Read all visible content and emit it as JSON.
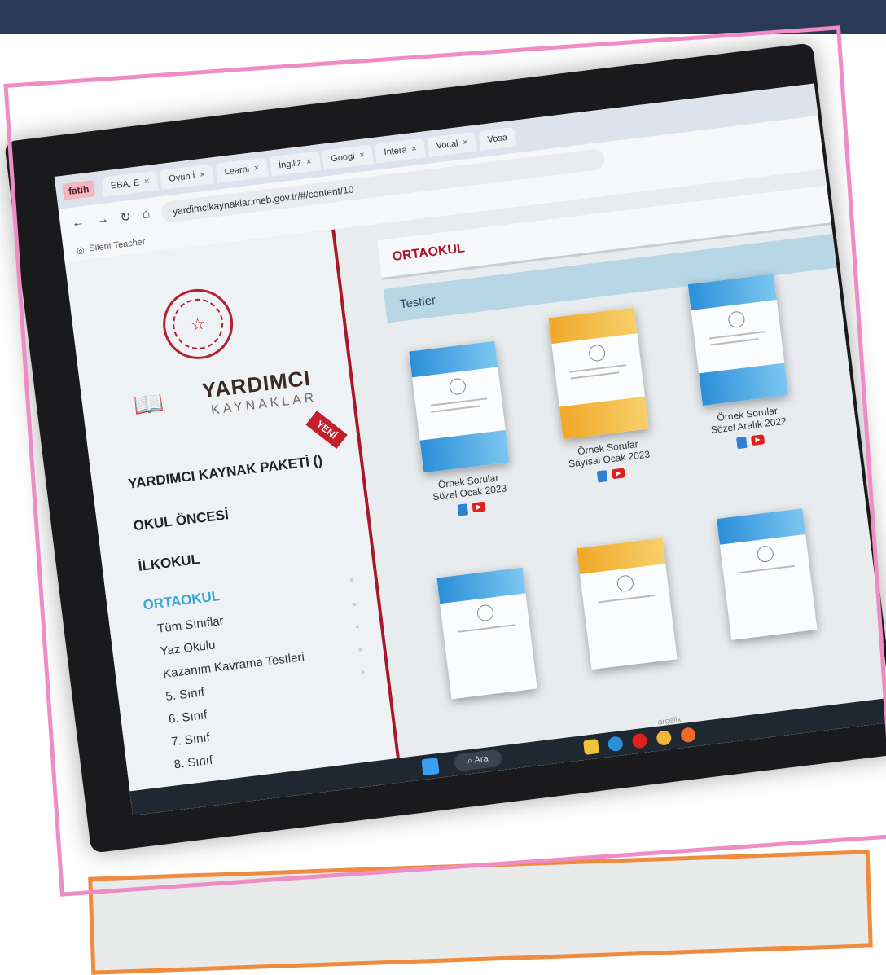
{
  "browser": {
    "badge": "fatih",
    "tabs": [
      {
        "label": "EBA, E",
        "icon": "eba-icon"
      },
      {
        "label": "Oyun İ",
        "icon": "kahoot-icon"
      },
      {
        "label": "Learni",
        "icon": "learning-icon"
      },
      {
        "label": "İngiliz",
        "icon": "image-icon"
      },
      {
        "label": "Googl",
        "icon": "google-forms-icon"
      },
      {
        "label": "Intera",
        "icon": "chart-icon"
      },
      {
        "label": "Vocal",
        "icon": "globe-icon"
      },
      {
        "label": "Vosa",
        "icon": "vosa-icon"
      }
    ],
    "url": "yardimcikaynaklar.meb.gov.tr/#/content/10",
    "bookmark": "Silent Teacher"
  },
  "sidebar": {
    "logo_title": "YARDIMCI",
    "logo_subtitle": "KAYNAKLAR",
    "new_badge": "YENİ",
    "menu": {
      "paket": "YARDIMCI KAYNAK PAKETİ ()",
      "okul_oncesi": "OKUL ÖNCESİ",
      "ilkokul": "İLKOKUL",
      "ortaokul": "ORTAOKUL"
    },
    "sub_items": [
      "Tüm Sınıflar",
      "Yaz Okulu",
      "Kazanım Kavrama Testleri",
      "5. Sınıf",
      "6. Sınıf",
      "7. Sınıf",
      "8. Sınıf"
    ]
  },
  "main": {
    "header": "ORTAOKUL",
    "section": "Testler",
    "cards": [
      {
        "label": "Örnek Sorular Sözel Ocak 2023",
        "theme": "#2b8fd8"
      },
      {
        "label": "Örnek Sorular Sayısal Ocak 2023",
        "theme": "#f0a828"
      },
      {
        "label": "Örnek Sorular Sözel Aralık 2022",
        "theme": "#2b8fd8"
      }
    ]
  },
  "taskbar": {
    "search": "Ara",
    "brand": "arçelik"
  }
}
